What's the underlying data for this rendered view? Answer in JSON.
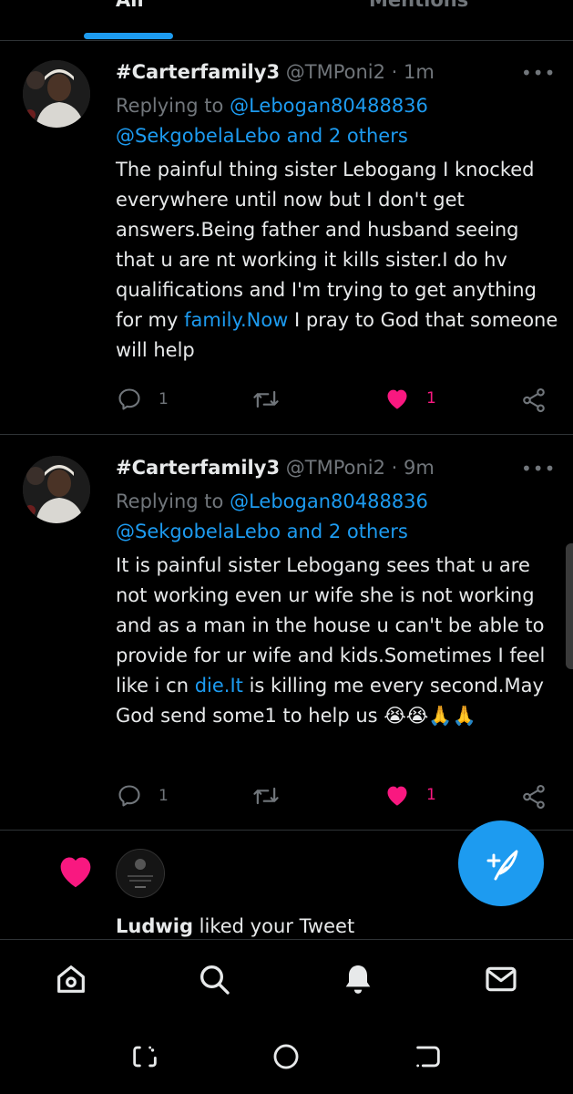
{
  "tabs": {
    "all": "All",
    "mentions": "Mentions"
  },
  "tweets": [
    {
      "name": "#Carterfamily3",
      "handle": "@TMPoni2",
      "time": "· 1m",
      "replying_prefix": "Replying to ",
      "reply_user1": "@Lebogan80488836",
      "reply_user2": "@SekgobelaLebo",
      "reply_and": " and ",
      "reply_others": "2 others",
      "body_pre": "The painful thing sister Lebogang I knocked everywhere until now but I don't get answers.Being father and husband seeing that u are nt working it kills sister.I do hv qualifications and I'm trying to get anything for my ",
      "body_link": "family.Now",
      "body_post": " I pray to God that someone will help",
      "reply_count": "1",
      "like_count": "1"
    },
    {
      "name": "#Carterfamily3",
      "handle": "@TMPoni2",
      "time": "· 9m",
      "replying_prefix": "Replying to ",
      "reply_user1": "@Lebogan80488836",
      "reply_user2": "@SekgobelaLebo",
      "reply_and": " and ",
      "reply_others": "2 others",
      "body_pre": "It is painful sister Lebogang sees that u are not working even ur wife she is not working and as a man in the house u can't be able to provide for ur wife and kids.Sometimes I feel like i cn ",
      "body_link": "die.It",
      "body_post": " is killing me every second.May God send some1 to help us 😭😭🙏🙏",
      "reply_count": "1",
      "like_count": "1"
    }
  ],
  "notification": {
    "user": "Ludwig",
    "text": " liked your Tweet"
  },
  "colors": {
    "accent": "#1d9bf0",
    "like": "#f91880",
    "muted": "#71767b"
  },
  "icons": [
    "reply-icon",
    "retweet-icon",
    "heart-icon",
    "share-icon",
    "more-icon",
    "home-icon",
    "search-icon",
    "bell-icon",
    "mail-icon",
    "compose-icon"
  ]
}
